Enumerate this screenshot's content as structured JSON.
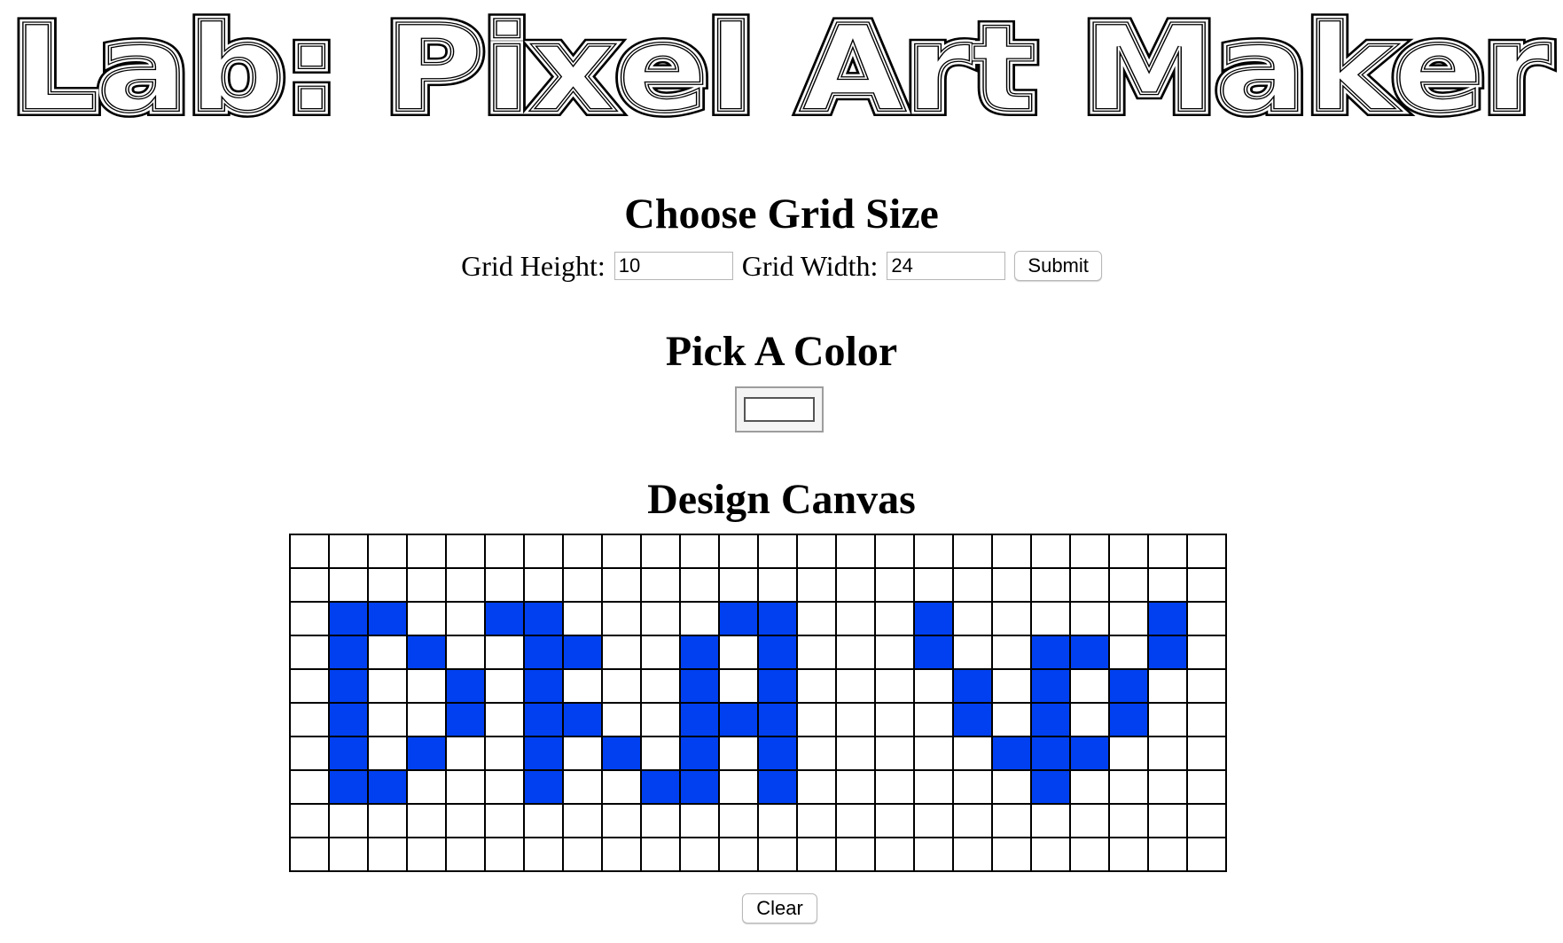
{
  "page": {
    "title": "Lab: Pixel Art Maker"
  },
  "grid_size": {
    "heading": "Choose Grid Size",
    "height_label": "Grid Height:",
    "height_value": "10",
    "width_label": "Grid Width:",
    "width_value": "24",
    "submit_label": "Submit"
  },
  "color": {
    "heading": "Pick A Color",
    "selected": "#ffffff"
  },
  "canvas": {
    "heading": "Design Canvas",
    "rows": 10,
    "cols": 24,
    "paint_color": "#0040f0",
    "empty_color": "#ffffff",
    "pixels": [
      "000000000000000000000000",
      "000000000000000000000000",
      "011001100001100010000010",
      "010100110010100010011010",
      "010010100010100001010100",
      "010010110011100001010100",
      "010100101010100000111000",
      "011000100110100000010000",
      "000000000000000000000000",
      "000000000000000000000000"
    ],
    "clear_label": "Clear"
  }
}
